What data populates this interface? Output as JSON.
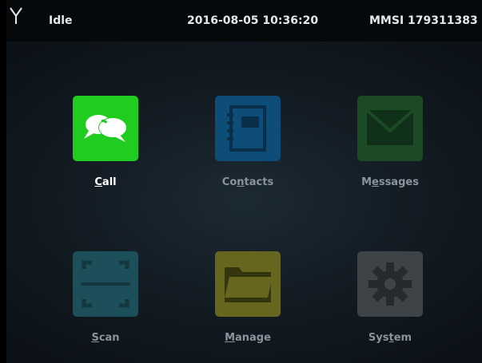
{
  "status_bar": {
    "state": "Idle",
    "datetime": "2016-08-05 10:36:20",
    "mmsi": "MMSI 179311383",
    "icons": {
      "antenna": "antenna-icon"
    }
  },
  "menu": {
    "items": [
      {
        "id": "call",
        "pre": "",
        "mnemonic": "C",
        "post": "all",
        "icon": "chat-bubbles-icon",
        "color": "#1fcc1f",
        "active": true
      },
      {
        "id": "contacts",
        "pre": "Co",
        "mnemonic": "n",
        "post": "tacts",
        "icon": "address-book-icon",
        "color": "#0d4d78",
        "active": false
      },
      {
        "id": "messages",
        "pre": "M",
        "mnemonic": "e",
        "post": "ssages",
        "icon": "envelope-icon",
        "color": "#1b4a25",
        "active": false
      },
      {
        "id": "scan",
        "pre": "",
        "mnemonic": "S",
        "post": "can",
        "icon": "scan-icon",
        "color": "#1d4f5a",
        "active": false
      },
      {
        "id": "manage",
        "pre": "",
        "mnemonic": "M",
        "post": "anage",
        "icon": "folder-icon",
        "color": "#66661f",
        "active": false
      },
      {
        "id": "system",
        "pre": "Sys",
        "mnemonic": "t",
        "post": "em",
        "icon": "gear-icon",
        "color": "#3d4347",
        "active": false
      }
    ]
  }
}
